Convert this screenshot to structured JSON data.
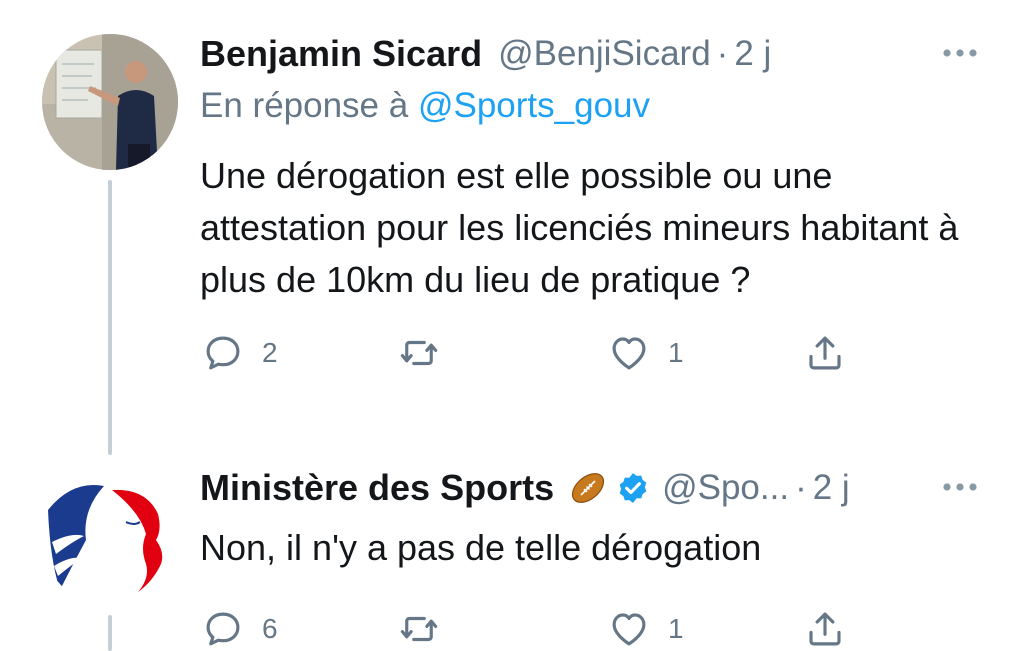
{
  "colors": {
    "text": "#14171a",
    "secondary": "#657786",
    "link": "#1da1f2",
    "thread": "#c4cfd6",
    "verified": "#1da1f2"
  },
  "tweets": [
    {
      "name": "Benjamin Sicard",
      "handle": "@BenjiSicard",
      "separator": "·",
      "time": "2 j",
      "reply_prefix": "En réponse à",
      "reply_mention": "@Sports_gouv",
      "text": "Une dérogation est elle possible ou une attestation pour les licenciés mineurs habitant à plus de 10km du lieu de pratique ?",
      "reply_count": "2",
      "retweet_count": "",
      "like_count": "1",
      "avatar_icon": "coach-photo-avatar",
      "more_icon": "more-options-icon"
    },
    {
      "name": "Ministère des Sports",
      "handle": "@Spo...",
      "separator": "·",
      "time": "2 j",
      "badges": [
        "rugby-ball-emoji",
        "verified-icon"
      ],
      "text": "Non, il n'y a pas de telle dérogation",
      "reply_count": "6",
      "retweet_count": "",
      "like_count": "1",
      "avatar_icon": "marianne-logo-avatar",
      "more_icon": "more-options-icon"
    }
  ]
}
